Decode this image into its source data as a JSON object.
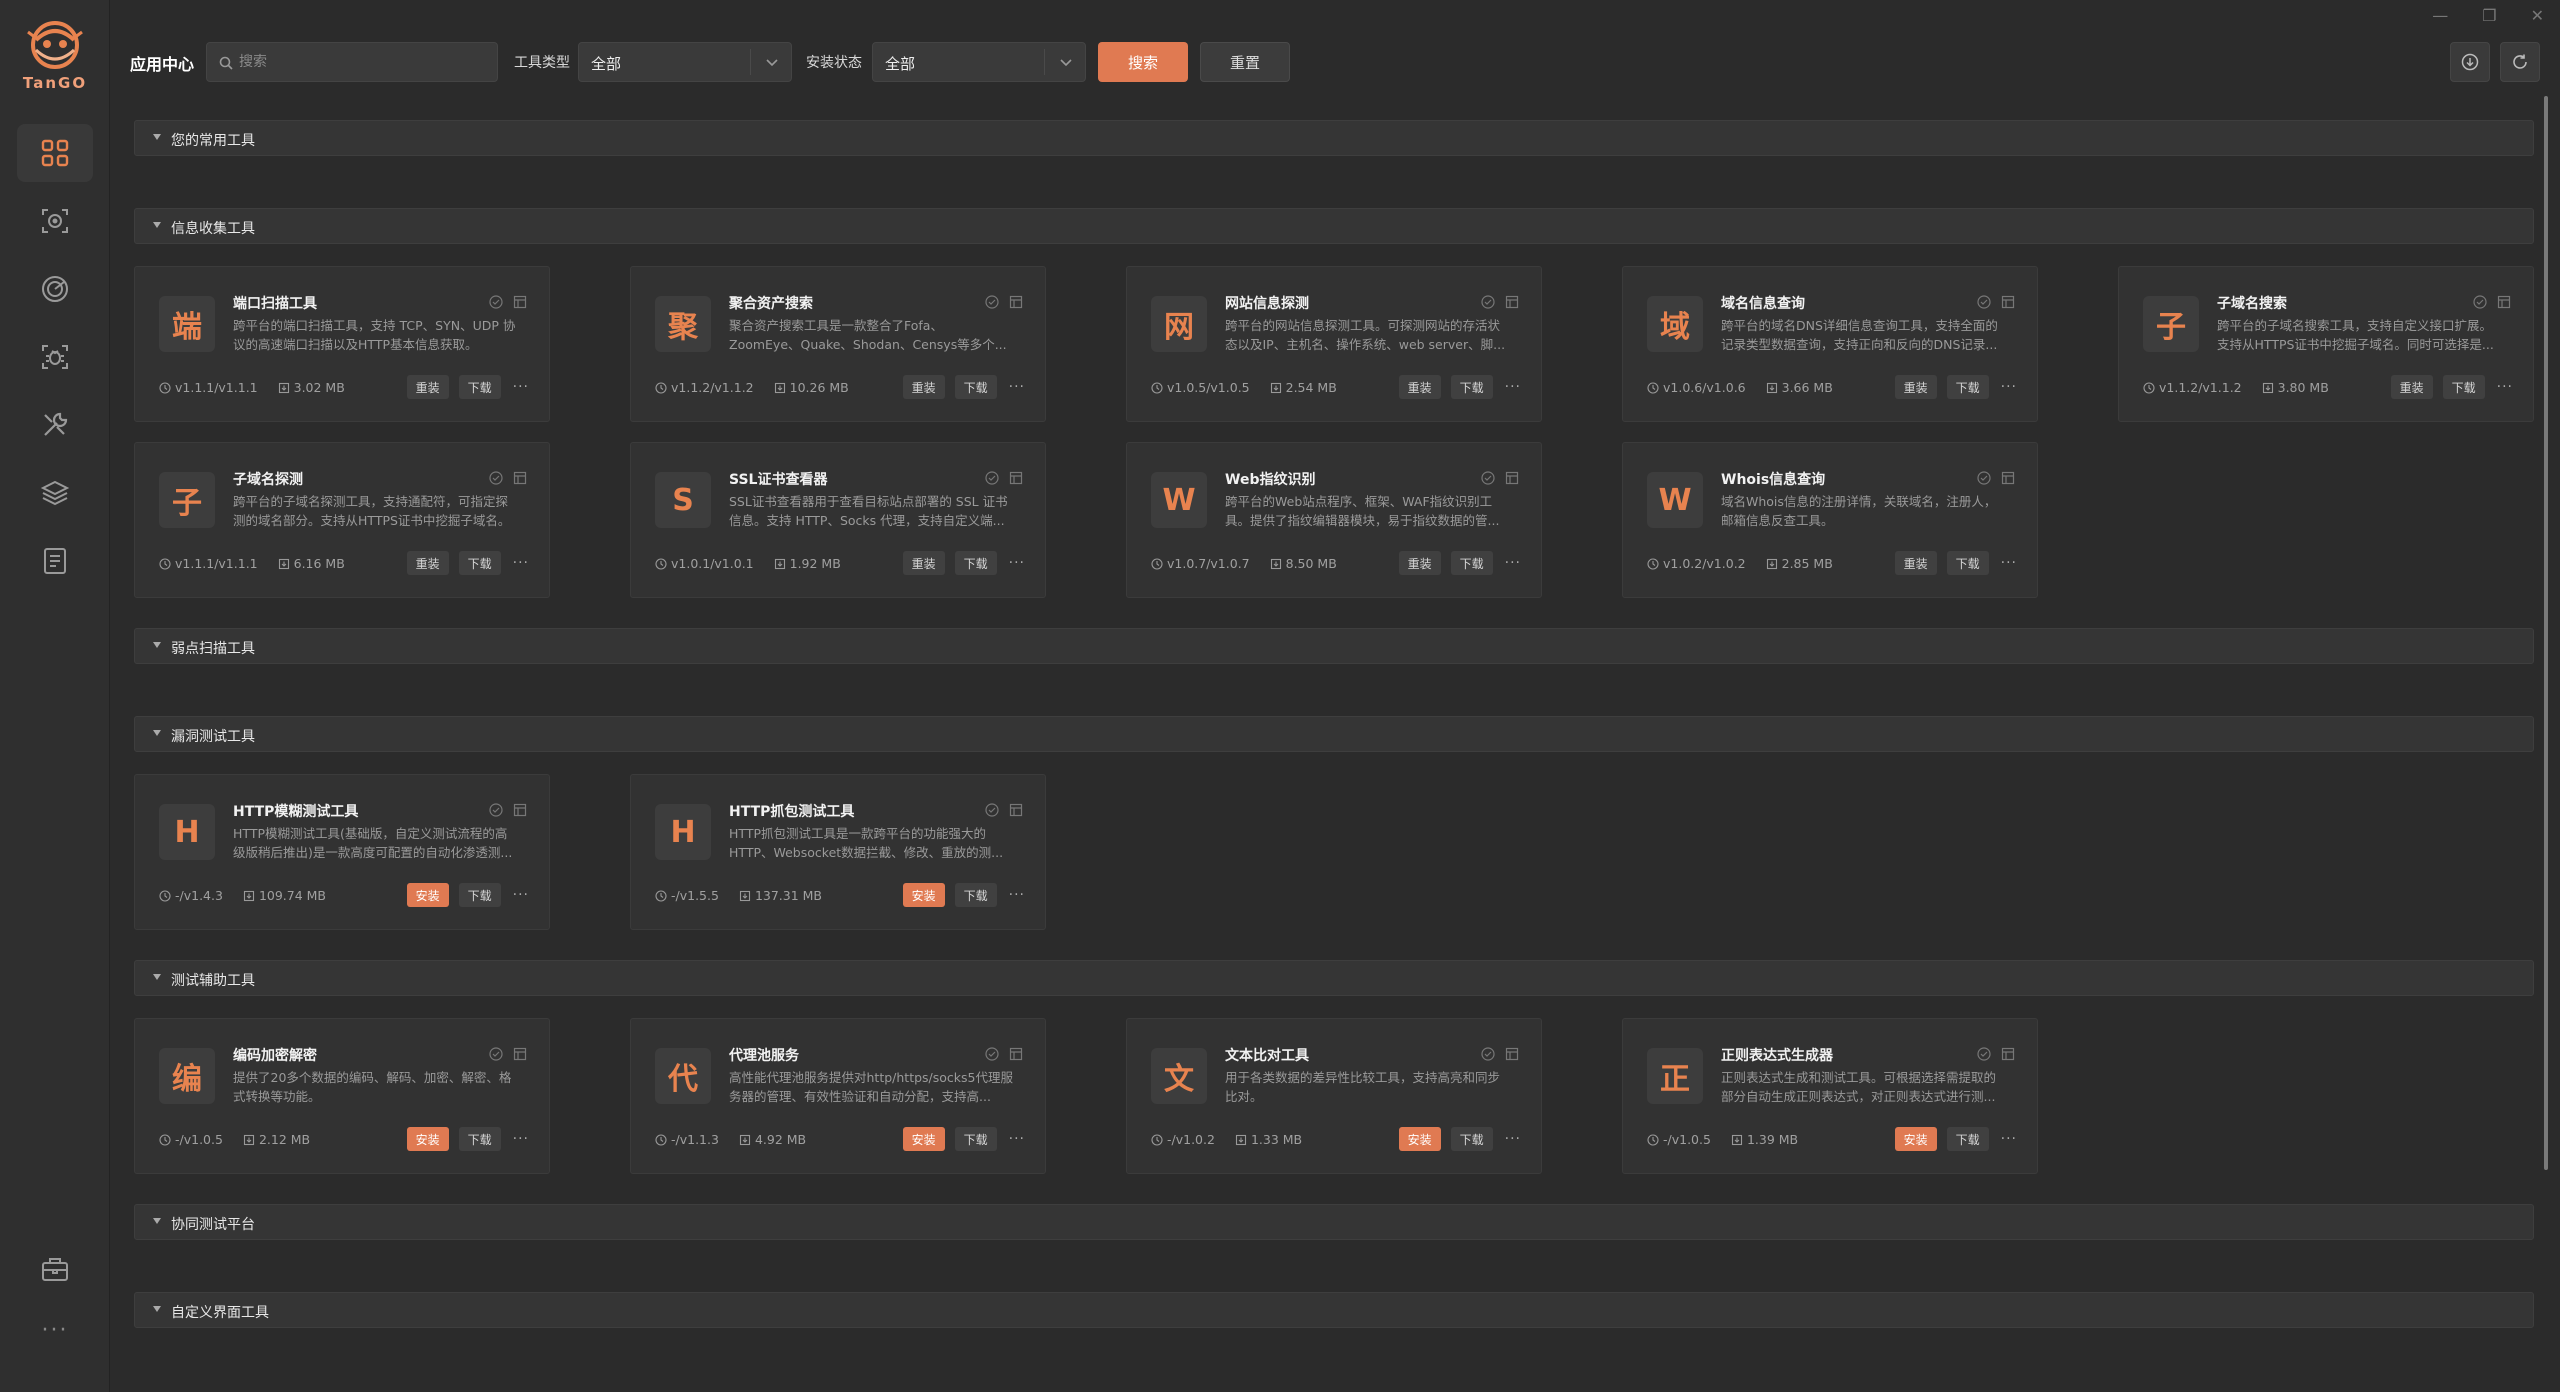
{
  "app": {
    "logo_text": "TanGO",
    "title": "应用中心"
  },
  "toolbar": {
    "search_placeholder": "搜索",
    "tool_type_label": "工具类型",
    "tool_type_value": "全部",
    "install_status_label": "安装状态",
    "install_status_value": "全部",
    "search_btn": "搜索",
    "reset_btn": "重置"
  },
  "sidebar_icons": [
    "apps-grid-icon",
    "scan-target-icon",
    "radar-icon",
    "bug-scan-icon",
    "tools-icon",
    "layers-icon",
    "notes-icon"
  ],
  "sections": [
    {
      "title": "您的常用工具"
    },
    {
      "title": "信息收集工具"
    },
    {
      "title": "弱点扫描工具"
    },
    {
      "title": "漏洞测试工具"
    },
    {
      "title": "测试辅助工具"
    },
    {
      "title": "协同测试平台"
    },
    {
      "title": "自定义界面工具"
    }
  ],
  "cards": [
    {
      "tile": "端",
      "name": "端口扫描工具",
      "desc": "跨平台的端口扫描工具，支持 TCP、SYN、UDP 协议的高速端口扫描以及HTTP基本信息获取。",
      "version": "v1.1.1/v1.1.1",
      "size": "3.02 MB",
      "btn": "重装",
      "download": "下载"
    },
    {
      "tile": "聚",
      "name": "聚合资产搜索",
      "desc": "聚合资产搜索工具是一款整合了Fofa、ZoomEye、Quake、Shodan、Censys等多个...",
      "version": "v1.1.2/v1.1.2",
      "size": "10.26 MB",
      "btn": "重装",
      "download": "下载"
    },
    {
      "tile": "网",
      "name": "网站信息探测",
      "desc": "跨平台的网站信息探测工具。可探测网站的存活状态以及IP、主机名、操作系统、web server、脚...",
      "version": "v1.0.5/v1.0.5",
      "size": "2.54 MB",
      "btn": "重装",
      "download": "下载"
    },
    {
      "tile": "域",
      "name": "域名信息查询",
      "desc": "跨平台的域名DNS详细信息查询工具，支持全面的记录类型数据查询，支持正向和反向的DNS记录...",
      "version": "v1.0.6/v1.0.6",
      "size": "3.66 MB",
      "btn": "重装",
      "download": "下载"
    },
    {
      "tile": "子",
      "name": "子域名搜索",
      "desc": "跨平台的子域名搜索工具，支持自定义接口扩展。支持从HTTPS证书中挖掘子域名。同时可选择是...",
      "version": "v1.1.2/v1.1.2",
      "size": "3.80 MB",
      "btn": "重装",
      "download": "下载"
    },
    {
      "tile": "子",
      "name": "子域名探测",
      "desc": "跨平台的子域名探测工具，支持通配符，可指定探测的域名部分。支持从HTTPS证书中挖掘子域名。",
      "version": "v1.1.1/v1.1.1",
      "size": "6.16 MB",
      "btn": "重装",
      "download": "下载"
    },
    {
      "tile": "S",
      "name": "SSL证书查看器",
      "desc": "SSL证书查看器用于查看目标站点部署的 SSL 证书信息。支持 HTTP、Socks 代理，支持自定义端...",
      "version": "v1.0.1/v1.0.1",
      "size": "1.92 MB",
      "btn": "重装",
      "download": "下载"
    },
    {
      "tile": "W",
      "name": "Web指纹识别",
      "desc": "跨平台的Web站点程序、框架、WAF指纹识别工具。提供了指纹编辑器模块，易于指纹数据的管...",
      "version": "v1.0.7/v1.0.7",
      "size": "8.50 MB",
      "btn": "重装",
      "download": "下载"
    },
    {
      "tile": "W",
      "name": "Whois信息查询",
      "desc": "域名Whois信息的注册详情，关联域名，注册人，邮箱信息反查工具。",
      "version": "v1.0.2/v1.0.2",
      "size": "2.85 MB",
      "btn": "重装",
      "download": "下载"
    },
    {
      "tile": "H",
      "name": "HTTP模糊测试工具",
      "desc": "HTTP模糊测试工具(基础版，自定义测试流程的高级版稍后推出)是一款高度可配置的自动化渗透测...",
      "version": "-/v1.4.3",
      "size": "109.74 MB",
      "btn": "安装",
      "download": "下载"
    },
    {
      "tile": "H",
      "name": "HTTP抓包测试工具",
      "desc": "HTTP抓包测试工具是一款跨平台的功能强大的HTTP、Websocket数据拦截、修改、重放的测...",
      "version": "-/v1.5.5",
      "size": "137.31 MB",
      "btn": "安装",
      "download": "下载"
    },
    {
      "tile": "编",
      "name": "编码加密解密",
      "desc": "提供了20多个数据的编码、解码、加密、解密、格式转换等功能。",
      "version": "-/v1.0.5",
      "size": "2.12 MB",
      "btn": "安装",
      "download": "下载"
    },
    {
      "tile": "代",
      "name": "代理池服务",
      "desc": "高性能代理池服务提供对http/https/socks5代理服务器的管理、有效性验证和自动分配，支持高...",
      "version": "-/v1.1.3",
      "size": "4.92 MB",
      "btn": "安装",
      "download": "下载"
    },
    {
      "tile": "文",
      "name": "文本比对工具",
      "desc": "用于各类数据的差异性比较工具，支持高亮和同步比对。",
      "version": "-/v1.0.2",
      "size": "1.33 MB",
      "btn": "安装",
      "download": "下载"
    },
    {
      "tile": "正",
      "name": "正则表达式生成器",
      "desc": "正则表达式生成和测试工具。可根据选择需提取的部分自动生成正则表达式，对正则表达式进行测...",
      "version": "-/v1.0.5",
      "size": "1.39 MB",
      "btn": "安装",
      "download": "下载"
    }
  ],
  "colors": {
    "accent": "#e07a52",
    "bg": "#2b2b2b",
    "card": "#323232"
  }
}
